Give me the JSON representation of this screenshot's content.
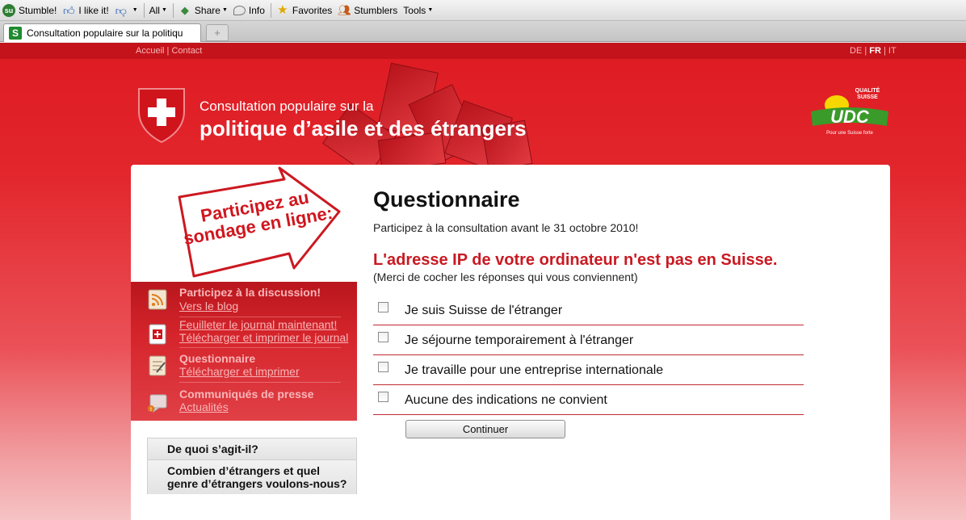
{
  "toolbar": {
    "items": [
      {
        "label": "Stumble!",
        "icon": "stumbleupon-icon"
      },
      {
        "label": "I like it!",
        "icon": "thumbs-up-icon"
      },
      {
        "label": "",
        "icon": "thumbs-down-icon"
      },
      {
        "label": "All",
        "icon": ""
      },
      {
        "label": "Share",
        "icon": "share-icon"
      },
      {
        "label": "Info",
        "icon": "info-icon"
      },
      {
        "label": "Favorites",
        "icon": "star-icon"
      },
      {
        "label": "Stumblers",
        "icon": "people-icon"
      },
      {
        "label": "Tools",
        "icon": ""
      }
    ]
  },
  "tab": {
    "title": "Consultation populaire sur la politiqu",
    "new_tab": "+"
  },
  "top_nav": {
    "home": "Accueil",
    "separator": " | ",
    "contact": "Contact"
  },
  "languages": {
    "de": "DE",
    "fr": "FR",
    "it": "IT",
    "sep": " | "
  },
  "header": {
    "subtitle": "Consultation populaire sur la",
    "title": "politique d’asile et des étrangers"
  },
  "logo": {
    "brand": "UDC",
    "quality": "QUALITÉ SUISSE",
    "tagline": "Pour une Suisse forte"
  },
  "banner": {
    "line1": "Participez au",
    "line2": "sondage en ligne:"
  },
  "side_menu": [
    {
      "title": "Participez à la discussion!",
      "links": [
        "Vers le blog"
      ]
    },
    {
      "title": "",
      "links": [
        "Feuilleter le journal maintenant!",
        "Télécharger et imprimer le journal"
      ]
    },
    {
      "title": "Questionnaire",
      "links": [
        "Télécharger et imprimer"
      ]
    },
    {
      "title": "Communiqués de presse",
      "links": [
        "Actualités"
      ]
    }
  ],
  "left_nav": [
    "De quoi s’agit-il?",
    "Combien d’étrangers et quel genre d’étrangers voulons-nous?"
  ],
  "questionnaire": {
    "title": "Questionnaire",
    "intro": "Participez à la consultation avant le 31 octobre 2010!",
    "warning": "L'adresse IP de votre ordinateur n'est pas en Suisse.",
    "hint": "(Merci de cocher les réponses qui vous conviennent)",
    "options": [
      "Je suis Suisse de l'étranger",
      "Je séjourne temporairement à l'étranger",
      "Je travaille pour une entreprise internationale",
      "Aucune des indications ne convient"
    ],
    "continue": "Continuer"
  },
  "colors": {
    "brand_red": "#d0161e",
    "warning_red": "#c81a22",
    "udc_green": "#3a9a2a"
  }
}
